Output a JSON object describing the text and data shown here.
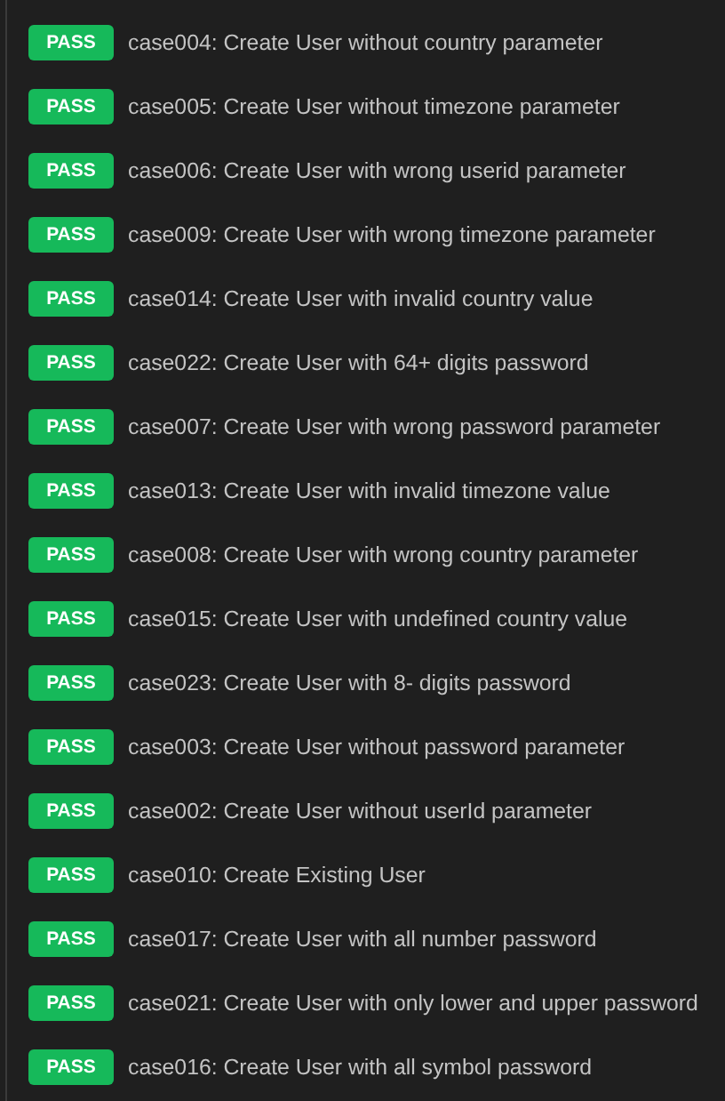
{
  "results": [
    {
      "kind": "passed",
      "badge": "PASS",
      "title": "case004: Create User without country parameter"
    },
    {
      "kind": "passed",
      "badge": "PASS",
      "title": "case005: Create User without timezone parameter"
    },
    {
      "kind": "passed",
      "badge": "PASS",
      "title": "case006: Create User with wrong userid parameter"
    },
    {
      "kind": "passed",
      "badge": "PASS",
      "title": "case009: Create User with wrong timezone parameter"
    },
    {
      "kind": "passed",
      "badge": "PASS",
      "title": "case014: Create User with invalid country value"
    },
    {
      "kind": "passed",
      "badge": "PASS",
      "title": "case022: Create User with 64+ digits password"
    },
    {
      "kind": "passed",
      "badge": "PASS",
      "title": "case007: Create User with wrong password parameter"
    },
    {
      "kind": "passed",
      "badge": "PASS",
      "title": "case013: Create User with invalid timezone value"
    },
    {
      "kind": "passed",
      "badge": "PASS",
      "title": "case008: Create User with wrong country parameter"
    },
    {
      "kind": "passed",
      "badge": "PASS",
      "title": "case015: Create User with undefined country value"
    },
    {
      "kind": "passed",
      "badge": "PASS",
      "title": "case023: Create User with 8- digits password"
    },
    {
      "kind": "passed",
      "badge": "PASS",
      "title": "case003: Create User without password parameter"
    },
    {
      "kind": "passed",
      "badge": "PASS",
      "title": "case002: Create User without userId parameter"
    },
    {
      "kind": "passed",
      "badge": "PASS",
      "title": "case010: Create Existing User"
    },
    {
      "kind": "passed",
      "badge": "PASS",
      "title": "case017: Create User with all number password"
    },
    {
      "kind": "passed",
      "badge": "PASS",
      "title": "case021: Create User with only lower and upper password"
    },
    {
      "kind": "passed",
      "badge": "PASS",
      "title": "case016: Create User with all symbol password"
    }
  ]
}
